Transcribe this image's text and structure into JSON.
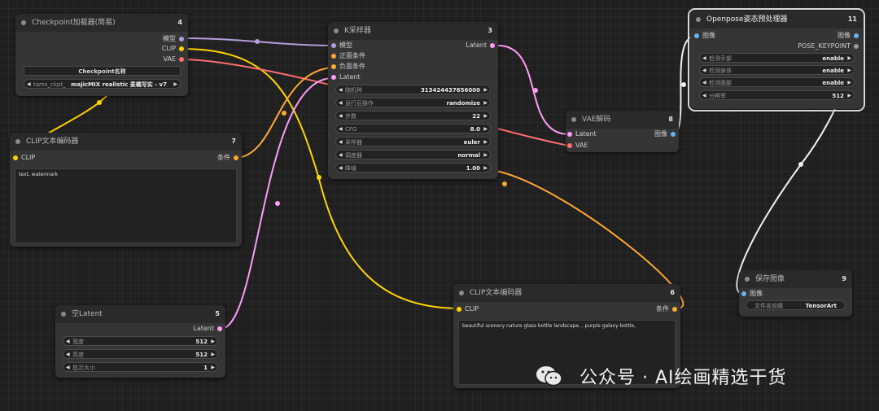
{
  "nodes": {
    "checkpoint": {
      "title": "Checkpoint加载器(简易)",
      "id": "4",
      "outputs": [
        "模型",
        "CLIP",
        "VAE"
      ],
      "ckpt_label": "Checkpoint名称",
      "ckpt_value_prefix": "tams_ckpt_",
      "ckpt_value": "majicMIX realistic 麦橘写实 - v7"
    },
    "clip_neg": {
      "title": "CLIP文本编码器",
      "id": "7",
      "input": "CLIP",
      "output": "条件",
      "text": "text, watermark"
    },
    "empty_latent": {
      "title": "空Latent",
      "id": "5",
      "output": "Latent",
      "widgets": [
        {
          "label": "宽度",
          "value": "512"
        },
        {
          "label": "高度",
          "value": "512"
        },
        {
          "label": "批次大小",
          "value": "1"
        }
      ]
    },
    "ksampler": {
      "title": "K采样器",
      "id": "3",
      "inputs": [
        "模型",
        "正面条件",
        "负面条件",
        "Latent"
      ],
      "output": "Latent",
      "widgets": [
        {
          "label": "随机种",
          "value": "313424437656000"
        },
        {
          "label": "运行后操作",
          "value": "randomize"
        },
        {
          "label": "步数",
          "value": "22"
        },
        {
          "label": "CFG",
          "value": "8.0"
        },
        {
          "label": "采样器",
          "value": "euler"
        },
        {
          "label": "调度器",
          "value": "normal"
        },
        {
          "label": "降噪",
          "value": "1.00"
        }
      ]
    },
    "vae_decode": {
      "title": "VAE解码",
      "id": "8",
      "inputs": [
        "Latent",
        "VAE"
      ],
      "output": "图像"
    },
    "clip_pos": {
      "title": "CLIP文本编码器",
      "id": "6",
      "input": "CLIP",
      "output": "条件",
      "text": "beautiful scenery nature glass bottle landscape, , purple galaxy bottle,"
    },
    "openpose": {
      "title": "Openpose姿态预处理器",
      "id": "11",
      "input": "图像",
      "outputs": [
        "图像",
        "POSE_KEYPOINT"
      ],
      "widgets": [
        {
          "label": "检测手部",
          "value": "enable"
        },
        {
          "label": "检测身体",
          "value": "enable"
        },
        {
          "label": "检测面部",
          "value": "enable"
        },
        {
          "label": "分辨率",
          "value": "512"
        }
      ]
    },
    "save_image": {
      "title": "保存图像",
      "id": "9",
      "input": "图像",
      "widget": {
        "label": "文件名前缀",
        "value": "TensorArt"
      }
    }
  },
  "watermark": {
    "text": "公众号 · AI绘画精选干货"
  },
  "colors": {
    "model": "#b39ddb",
    "clip": "#ffd500",
    "vae": "#ff6e6e",
    "latent": "#ff9cf9",
    "conditioning": "#ffa931",
    "image": "#64b5f6",
    "keypoint": "#999999",
    "canvas": "#202020",
    "node": "#353535",
    "title": "#2a2a2a"
  }
}
